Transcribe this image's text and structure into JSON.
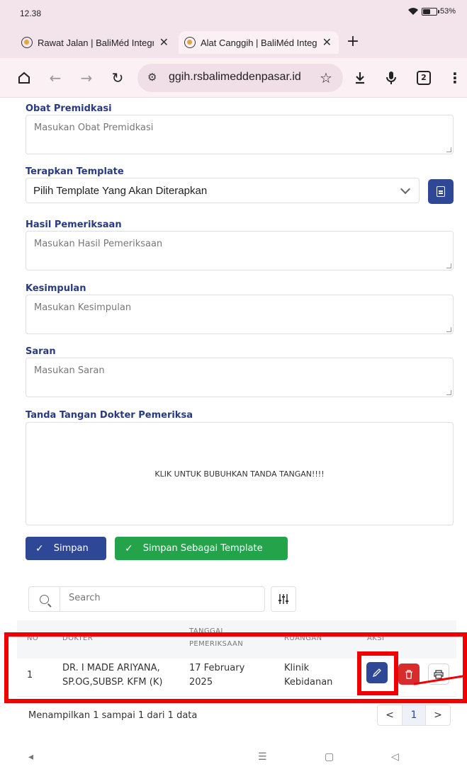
{
  "status": {
    "time": "12.38",
    "battery": "53%",
    "battery_level": 0.53
  },
  "tabs": [
    {
      "title": "Rawat Jalan | BaliMéd Integr",
      "close": "✕"
    },
    {
      "title": "Alat Canggih | BaliMéd Integ",
      "close": "✕"
    }
  ],
  "toolbar": {
    "url": "ggih.rsbalimeddenpasar.id",
    "tab_count": "2"
  },
  "form": {
    "obat": {
      "label": "Obat Premidkasi",
      "placeholder": "Masukan Obat Premidkasi"
    },
    "template": {
      "label": "Terapkan Template",
      "selected": "Pilih Template Yang Akan Diterapkan"
    },
    "hasil": {
      "label": "Hasil Pemeriksaan",
      "placeholder": "Masukan Hasil Pemeriksaan"
    },
    "kesimpulan": {
      "label": "Kesimpulan",
      "placeholder": "Masukan Kesimpulan"
    },
    "saran": {
      "label": "Saran",
      "placeholder": "Masukan Saran"
    },
    "signature": {
      "label": "Tanda Tangan Dokter Pemeriksa",
      "prompt": "KLIK UNTUK BUBUHKAN TANDA TANGAN!!!!"
    },
    "buttons": {
      "save": "Simpan",
      "save_template": "Simpan Sebagai Template"
    }
  },
  "table": {
    "search_placeholder": "Search",
    "headers": {
      "no": "NO",
      "dokter": "DOKTER",
      "tanggal_1": "TANGGAL",
      "tanggal_2": "PEMERIKSAAN",
      "ruangan": "RUANGAN",
      "aksi": "AKSI"
    },
    "rows": [
      {
        "no": "1",
        "dokter_1": "DR. I MADE ARIYANA,",
        "dokter_2": "SP.OG,SUBSP. KFM (K)",
        "tanggal_1": "17 February",
        "tanggal_2": "2025",
        "ruangan_1": "Klinik",
        "ruangan_2": "Kebidanan"
      }
    ],
    "info": "Menampilkan 1 sampai 1 dari 1 data",
    "pagination": {
      "prev": "<",
      "page": "1",
      "next": ">"
    }
  },
  "colors": {
    "primary": "#2e4797",
    "success": "#24a34a",
    "danger": "#d92b2b",
    "highlight": "#f00000"
  }
}
